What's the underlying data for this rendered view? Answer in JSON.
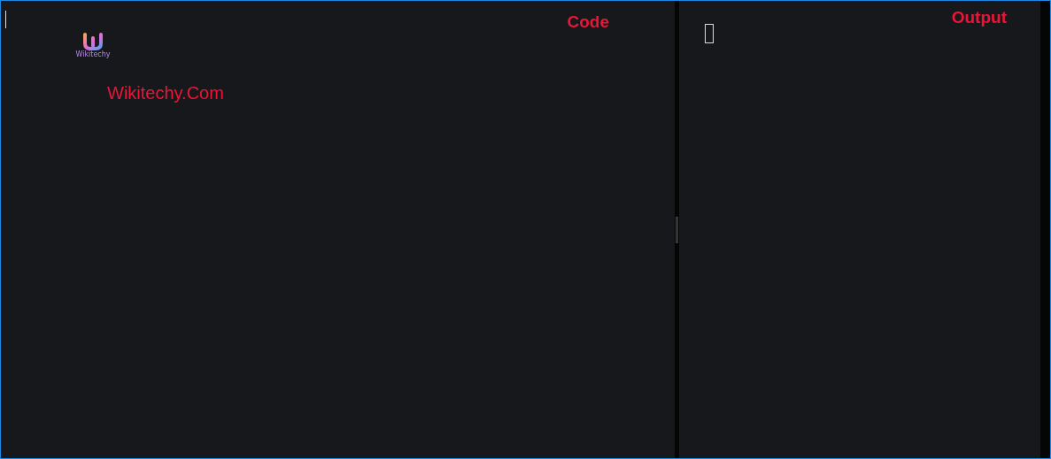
{
  "code_panel": {
    "label": "Code",
    "logo_text": "Wikitechy",
    "site_text": "Wikitechy.Com"
  },
  "output_panel": {
    "label": "Output"
  }
}
